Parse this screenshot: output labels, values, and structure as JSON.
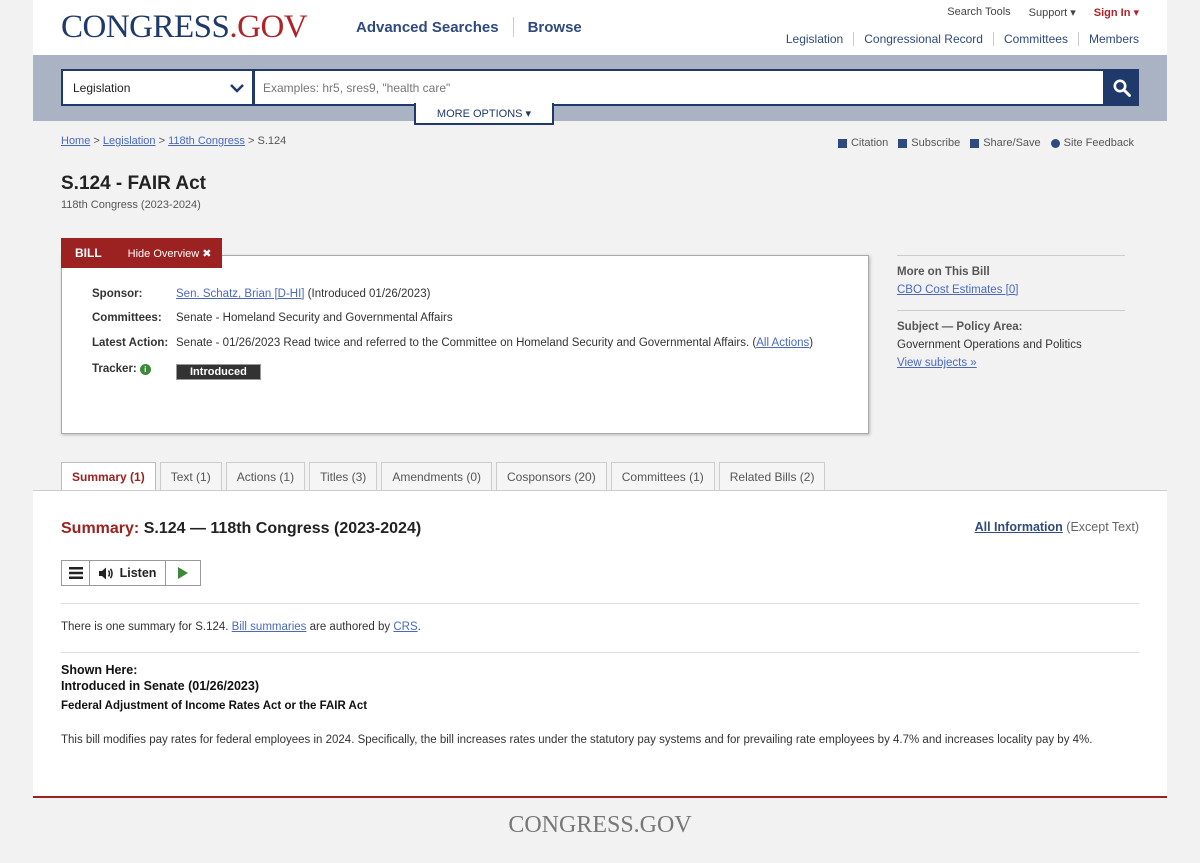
{
  "header": {
    "logo_main": "CONGRESS",
    "logo_dot": ".",
    "logo_gov": "GOV",
    "nav": [
      "Advanced Searches",
      "Browse"
    ],
    "util": {
      "search_tools": "Search Tools",
      "support": "Support ▾",
      "sign_in": "Sign In ▾"
    },
    "subnav": [
      "Legislation",
      "Congressional Record",
      "Committees",
      "Members"
    ]
  },
  "search": {
    "collection": "Legislation",
    "placeholder": "Examples: hr5, sres9, \"health care\"",
    "more_options": "MORE OPTIONS ▾"
  },
  "breadcrumb": {
    "home": "Home",
    "legislation": "Legislation",
    "congress": "118th Congress",
    "current": "S.124",
    "sep": ">"
  },
  "tools": {
    "citation": "Citation",
    "subscribe": "Subscribe",
    "share": "Share/Save",
    "feedback": "Site Feedback"
  },
  "bill": {
    "title": "S.124 - FAIR Act",
    "congress": "118th Congress (2023-2024)",
    "tab_label": "BILL",
    "hide_overview": "Hide Overview ✖",
    "sponsor_label": "Sponsor:",
    "sponsor_link": "Sen. Schatz, Brian [D-HI]",
    "sponsor_rest": " (Introduced 01/26/2023)",
    "committees_label": "Committees:",
    "committees_value": "Senate - Homeland Security and Governmental Affairs",
    "latest_label": "Latest Action:",
    "latest_value": "Senate - 01/26/2023 Read twice and referred to the Committee on Homeland Security and Governmental Affairs.  (",
    "all_actions": "All Actions",
    "latest_close": ")",
    "tracker_label": "Tracker:",
    "tracker_value": "Introduced"
  },
  "side": {
    "more_title": "More on This Bill",
    "cbo": "CBO Cost Estimates [0]",
    "subject_title": "Subject — Policy Area:",
    "policy_area": "Government Operations and Politics",
    "view_subjects": "View subjects »"
  },
  "tabs": [
    "Summary (1)",
    "Text (1)",
    "Actions (1)",
    "Titles (3)",
    "Amendments (0)",
    "Cosponsors (20)",
    "Committees (1)",
    "Related Bills (2)"
  ],
  "summary": {
    "label": "Summary:",
    "heading": "S.124 — 118th Congress (2023-2024)",
    "all_info": "All Information",
    "except": " (Except Text)",
    "listen": "Listen",
    "intro_a": "There is one summary for S.124. ",
    "bill_summaries": "Bill summaries",
    "intro_b": " are authored by ",
    "crs": "CRS",
    "intro_c": ".",
    "shown_here": "Shown Here:",
    "introduced": "Introduced in Senate (01/26/2023)",
    "act_name": "Federal Adjustment of Income Rates Act or the FAIR Act",
    "body": "This bill modifies pay rates for federal employees in 2024. Specifically, the bill increases rates under the statutory pay systems and for prevailing rate employees by 4.7% and increases locality pay by 4%."
  },
  "footer": {
    "logo": "CONGRESS.GOV"
  },
  "colors": {
    "navy": "#1f3a6a",
    "brand_red": "#9c2121",
    "link": "#4a69bd",
    "band": "#aab3c4"
  }
}
